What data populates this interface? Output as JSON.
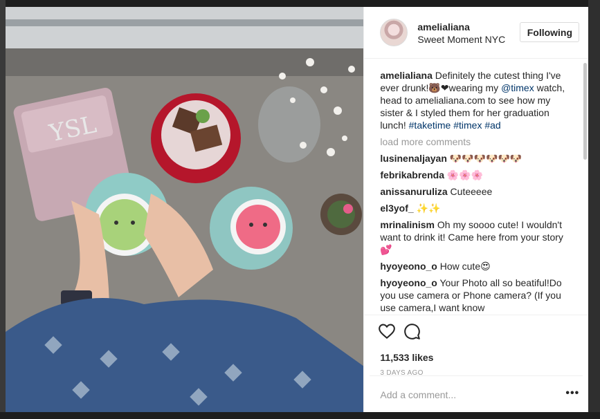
{
  "post": {
    "username": "amelialiana",
    "location": "Sweet Moment NYC",
    "follow_label": "Following",
    "caption": {
      "user": "amelialiana",
      "text_1": " Definitely the cutest thing I've ever drunk!🐻❤wearing my ",
      "mention": "@timex",
      "text_2": " watch, head to amelialiana.com to see how my sister & I styled them for her graduation lunch! ",
      "tags": "#taketime #timex #ad"
    },
    "load_more": "load more comments",
    "comments": [
      {
        "user": "lusinenaljayan",
        "text": " 🐶🐶🐶🐶🐶🐶"
      },
      {
        "user": "febrikabrenda",
        "text": " 🌸🌸🌸"
      },
      {
        "user": "anissanuruliza",
        "text": " Cuteeeee"
      },
      {
        "user": "el3yof_",
        "text": " ✨✨"
      },
      {
        "user": "mrinalinism",
        "text": " Oh my soooo cute! I wouldn't want to drink it! Came here from your story 💕"
      },
      {
        "user": "hyoyeono_o",
        "text": " How cute😍"
      },
      {
        "user": "hyoyeono_o",
        "text": " Your Photo all so beatiful!Do you use camera or Phone camera? (If you use camera,I want know"
      }
    ],
    "likes": "11,533 likes",
    "time": "3 DAYS AGO",
    "add_comment_placeholder": "Add a comment...",
    "more_options": "•••",
    "icons": {
      "like": "heart-icon",
      "comment": "speech-bubble-icon"
    }
  }
}
